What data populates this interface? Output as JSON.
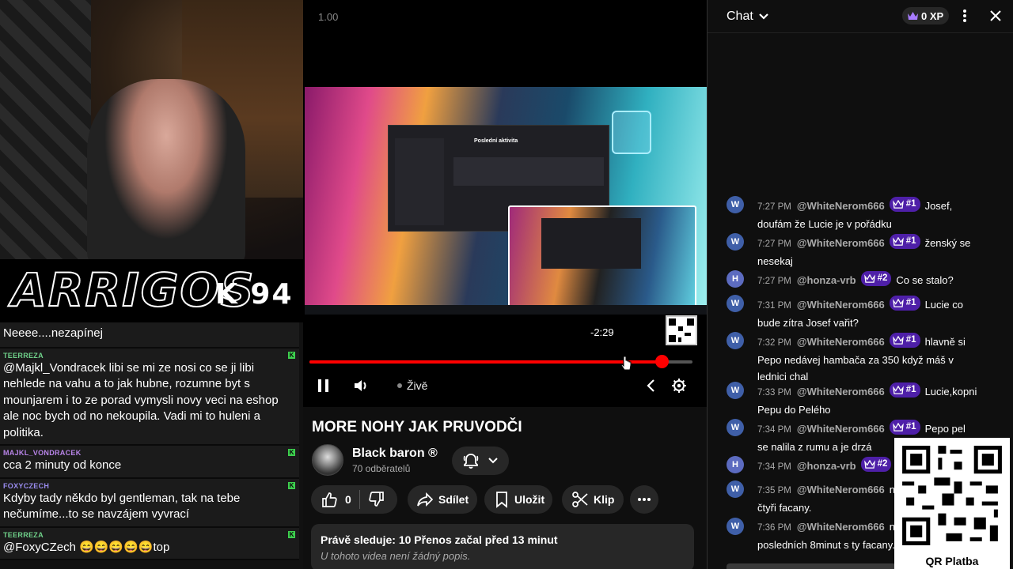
{
  "overlay": {
    "logo_text": "ARRIGOS",
    "logo_suffix": "K 94",
    "messages": [
      {
        "user": "",
        "text": "Neeee....nezapínej",
        "user_color": "#ffffff"
      },
      {
        "user": "TEERREZA",
        "text": "@Majkl_Vondracek libi se mi ze nosi co se ji libi nehlede na vahu a to jak hubne, rozumne byt s mounjarem i to ze porad vymysli novy veci na eshop ale noc bych od no nekoupila. Vadi mi to huleni a politika.",
        "user_color": "#6fd18a"
      },
      {
        "user": "MAJKL_VONDRACEK",
        "text": "cca 2 minuty od konce",
        "user_color": "#b884e8"
      },
      {
        "user": "FOXYCZECH",
        "text": "Kdyby tady někdo byl gentleman, tak na tebe nečumíme...to se navzájem vyvrací",
        "user_color": "#9a8cf0"
      },
      {
        "user": "TEERREZA",
        "text": "@FoxyCZech 😄😄😄😄😄top",
        "user_color": "#6fd18a"
      }
    ]
  },
  "player": {
    "speed_label": "1.00",
    "time_remaining": "-2:29",
    "progress": 0.92,
    "live_label": "Živě",
    "embedded_window_title": "Poslední aktivita"
  },
  "video": {
    "title": "MORE NOHY JAK PRUVODČI",
    "channel_name": "Black baron ®",
    "subscribers": "70 odběratelů",
    "like_count": "0",
    "share_label": "Sdílet",
    "save_label": "Uložit",
    "clip_label": "Klip",
    "stats": "Právě sleduje: 10  Přenos začal před 13 minut",
    "description": "U tohoto videa není žádný popis."
  },
  "chat": {
    "title": "Chat",
    "xp": "0 XP",
    "messages": [
      {
        "avatar": "W",
        "avatar_color": "#3f5fa8",
        "time": "7:27 PM",
        "author": "@WhiteNerom666",
        "rank": "#1",
        "text": "Josef, doufám že Lucie je v pořádku"
      },
      {
        "avatar": "W",
        "avatar_color": "#3f5fa8",
        "time": "7:27 PM",
        "author": "@WhiteNerom666",
        "rank": "#1",
        "text": "ženský se nesekaj"
      },
      {
        "avatar": "H",
        "avatar_color": "#5c6bc0",
        "time": "7:27 PM",
        "author": "@honza-vrb",
        "rank": "#2",
        "text": "Co se stalo?"
      },
      {
        "avatar": "W",
        "avatar_color": "#3f5fa8",
        "time": "7:31 PM",
        "author": "@WhiteNerom666",
        "rank": "#1",
        "text": "Lucie co bude zítra Josef vařit?"
      },
      {
        "avatar": "W",
        "avatar_color": "#3f5fa8",
        "time": "7:32 PM",
        "author": "@WhiteNerom666",
        "rank": "#1",
        "text": "hlavně si Pepo nedávej hambača za 350 když máš v lednici chal"
      },
      {
        "avatar": "W",
        "avatar_color": "#3f5fa8",
        "time": "7:33 PM",
        "author": "@WhiteNerom666",
        "rank": "#1",
        "text": "Lucie,kopni Pepu do Pelého"
      },
      {
        "avatar": "W",
        "avatar_color": "#3f5fa8",
        "time": "7:34 PM",
        "author": "@WhiteNerom666",
        "rank": "#1",
        "text": "Pepo pel se nalila z rumu a je drzá"
      },
      {
        "avatar": "H",
        "avatar_color": "#5c6bc0",
        "time": "7:34 PM",
        "author": "@honza-vrb",
        "rank": "#2",
        "text": ""
      },
      {
        "avatar": "W",
        "avatar_color": "#3f5fa8",
        "time": "7:35 PM",
        "author": "@WhiteNerom666",
        "rank": "",
        "text": "nenapsali,padly čtyři facany."
      },
      {
        "avatar": "W",
        "avatar_color": "#3f5fa8",
        "time": "7:36 PM",
        "author": "@WhiteNerom666",
        "rank": "",
        "text": "na .jutubu, posledních 8minut s ty facany."
      }
    ],
    "qr_label": "QR Platba"
  },
  "colors": {
    "accent_red": "#ff0000",
    "rank_purple": "#4e1fa8",
    "live_green": "#3dd04e"
  },
  "icons": [
    "pause-icon",
    "volume-icon",
    "chevron-left-icon",
    "settings-icon",
    "bell-icon",
    "chevron-down-icon",
    "like-icon",
    "dislike-icon",
    "share-icon",
    "save-icon",
    "clip-icon",
    "more-icon",
    "crown-icon",
    "kebab-icon",
    "close-icon"
  ]
}
